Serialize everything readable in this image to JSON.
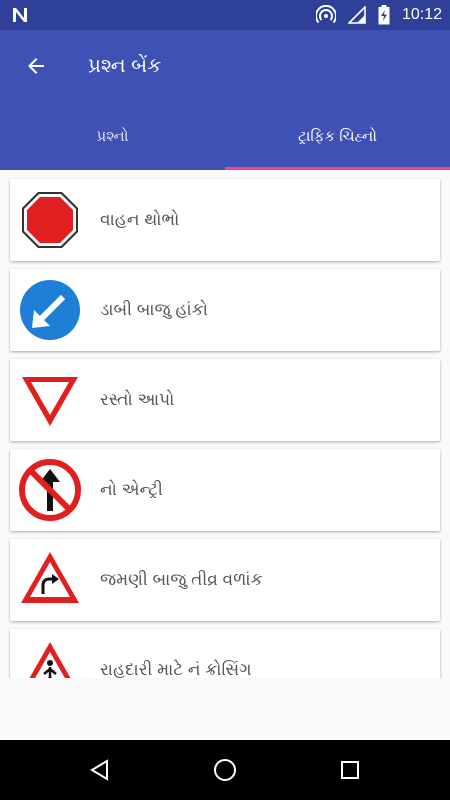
{
  "status_bar": {
    "time": "10:12",
    "icons": [
      "notification-n-icon",
      "hotspot-icon",
      "signal-icon",
      "battery-charging-icon"
    ]
  },
  "app_bar": {
    "title": "પ્રશ્ન બેંક",
    "back_icon": "arrow-back-icon"
  },
  "tabs": [
    {
      "label": "પ્રશ્નો",
      "selected": false
    },
    {
      "label": "ટ્રાફિક ચિહ્નો",
      "selected": true
    }
  ],
  "colors": {
    "primary": "#3f51b5",
    "primary_dark": "#2f4099",
    "accent": "#ff4081",
    "sign_red": "#e02020",
    "sign_blue": "#1f7fd6"
  },
  "signs": [
    {
      "label": "વાહન થોભો",
      "icon": "stop-sign-icon"
    },
    {
      "label": "ડાબી બાજુ હાંકો",
      "icon": "keep-left-sign-icon"
    },
    {
      "label": "રસ્તો આપો",
      "icon": "give-way-sign-icon"
    },
    {
      "label": "નો એન્ટ્રી",
      "icon": "no-entry-sign-icon"
    },
    {
      "label": "જમણી બાજુ તીવ્ર વળાંક",
      "icon": "right-curve-sign-icon"
    },
    {
      "label": "રાહદારી માટે નં ક્રોસિંગ",
      "icon": "pedestrian-crossing-sign-icon"
    }
  ],
  "nav_bar": {
    "buttons": [
      "back-triangle-icon",
      "home-circle-icon",
      "recents-square-icon"
    ]
  }
}
